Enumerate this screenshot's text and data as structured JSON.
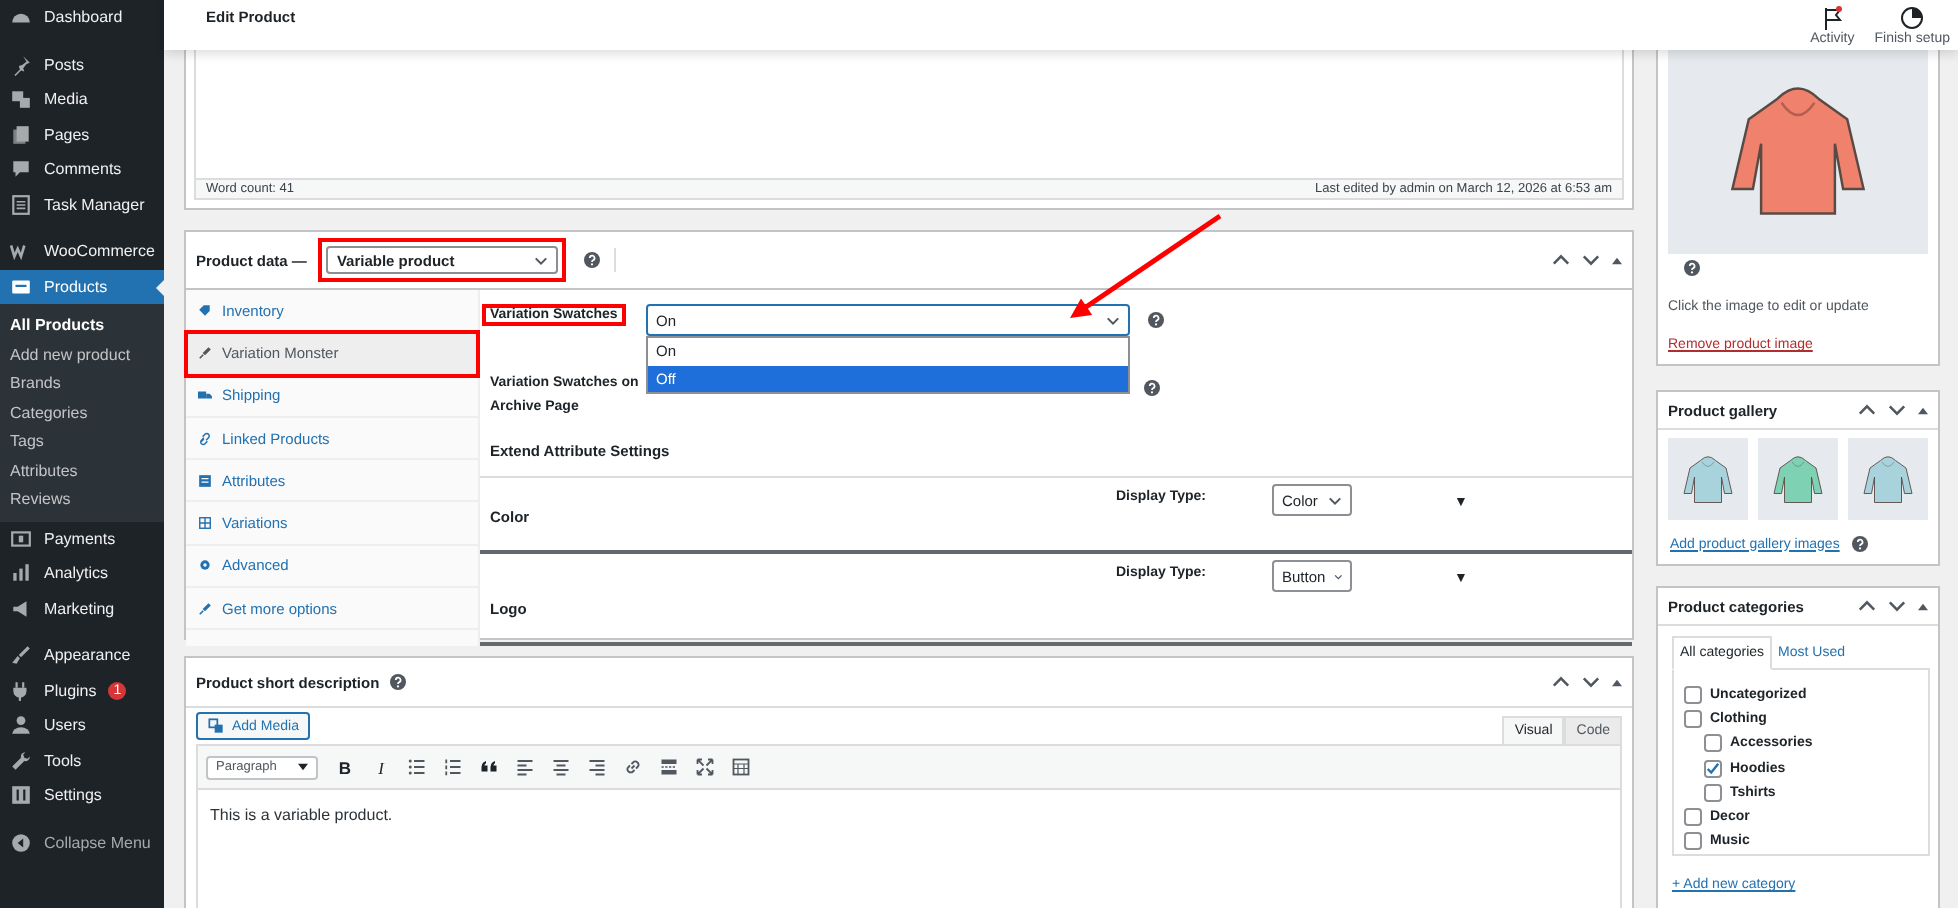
{
  "topbar": {
    "title": "Edit Product",
    "actions": [
      {
        "label": "Activity",
        "notification": true
      },
      {
        "label": "Finish setup",
        "notification": false
      }
    ]
  },
  "sidebar": {
    "sections": [
      [
        {
          "label": "Dashboard",
          "selected": false
        }
      ],
      [
        {
          "label": "Posts",
          "selected": false
        },
        {
          "label": "Media",
          "selected": false
        },
        {
          "label": "Pages",
          "selected": false
        },
        {
          "label": "Comments",
          "selected": false
        },
        {
          "label": "Task Manager",
          "selected": false
        }
      ],
      [
        {
          "label": "WooCommerce",
          "selected": false
        },
        {
          "label": "Products",
          "selected": true,
          "children": [
            {
              "label": "All Products",
              "selected": true
            },
            {
              "label": "Add new product",
              "selected": false
            },
            {
              "label": "Brands",
              "selected": false
            },
            {
              "label": "Categories",
              "selected": false
            },
            {
              "label": "Tags",
              "selected": false
            },
            {
              "label": "Attributes",
              "selected": false
            },
            {
              "label": "Reviews",
              "selected": false
            }
          ]
        },
        {
          "label": "Payments",
          "selected": false
        },
        {
          "label": "Analytics",
          "selected": false
        },
        {
          "label": "Marketing",
          "selected": false
        }
      ],
      [
        {
          "label": "Appearance",
          "selected": false
        },
        {
          "label": "Plugins",
          "selected": false,
          "badge": "1"
        },
        {
          "label": "Users",
          "selected": false
        },
        {
          "label": "Tools",
          "selected": false
        },
        {
          "label": "Settings",
          "selected": false
        }
      ]
    ],
    "collapse_label": "Collapse Menu"
  },
  "editor": {
    "word_count": "Word count: 41",
    "last_edited": "Last edited by admin on March 12, 2026 at 6:53 am"
  },
  "product_data": {
    "title": "Product data —",
    "type_select": {
      "value": "Variable product",
      "highlighted": true
    },
    "tabs": [
      {
        "label": "Inventory",
        "selected": false,
        "highlighted": false
      },
      {
        "label": "Variation Monster",
        "selected": true,
        "highlighted": true
      },
      {
        "label": "Shipping",
        "selected": false,
        "highlighted": false
      },
      {
        "label": "Linked Products",
        "selected": false,
        "highlighted": false
      },
      {
        "label": "Attributes",
        "selected": false,
        "highlighted": false
      },
      {
        "label": "Variations",
        "selected": false,
        "highlighted": false
      },
      {
        "label": "Advanced",
        "selected": false,
        "highlighted": false
      },
      {
        "label": "Get more options",
        "selected": false,
        "highlighted": false
      }
    ],
    "fields": [
      {
        "label": "Variation Swatches",
        "highlighted": true,
        "value": "On",
        "options": [
          {
            "label": "On",
            "hovered": false
          },
          {
            "label": "Off",
            "hovered": true
          }
        ]
      },
      {
        "label": "Variation Swatches on Archive Page",
        "highlighted": false
      }
    ],
    "section_title": "Extend Attribute Settings",
    "attributes": [
      {
        "name": "Color",
        "display_label": "Display Type:",
        "display_value": "Color",
        "toggle": "▼"
      },
      {
        "name": "Logo",
        "display_label": "Display Type:",
        "display_value": "Button",
        "toggle": "▼"
      }
    ]
  },
  "short_description": {
    "title": "Product short description",
    "add_media": "Add Media",
    "editor_tabs": [
      {
        "label": "Visual",
        "selected": true
      },
      {
        "label": "Code",
        "selected": false
      }
    ],
    "format": "Paragraph",
    "text_buttons": [
      "B",
      "I"
    ],
    "content": "This is a variable product."
  },
  "product_image": {
    "hint": "Click the image to edit or update",
    "remove_link": "Remove product image"
  },
  "product_gallery": {
    "title": "Product gallery",
    "add_link": "Add product gallery images"
  },
  "product_categories": {
    "title": "Product categories",
    "tabs": [
      {
        "label": "All categories",
        "selected": true
      },
      {
        "label": "Most Used",
        "selected": false
      }
    ],
    "categories": [
      {
        "label": "Uncategorized",
        "checked": false
      },
      {
        "label": "Clothing",
        "checked": false,
        "children": [
          {
            "label": "Accessories",
            "checked": false
          },
          {
            "label": "Hoodies",
            "checked": true
          },
          {
            "label": "Tshirts",
            "checked": false
          }
        ]
      },
      {
        "label": "Decor",
        "checked": false
      },
      {
        "label": "Music",
        "checked": false
      }
    ],
    "add_link": "+ Add new category"
  }
}
